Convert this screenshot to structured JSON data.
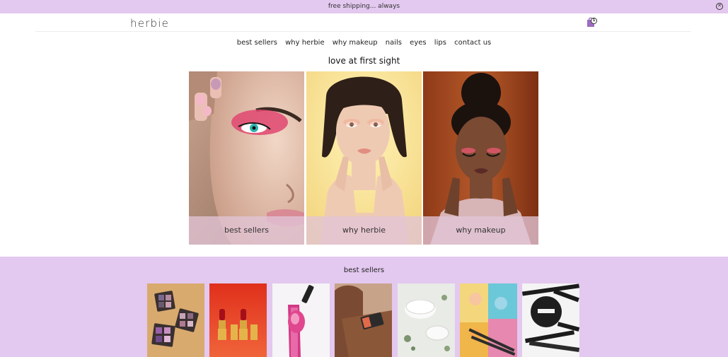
{
  "promo": {
    "text": "free shipping... always",
    "close_icon": "close-circle-icon"
  },
  "header": {
    "logo": "herbie",
    "cart_icon": "shopping-bag-icon",
    "cart_count": "1"
  },
  "nav": {
    "items": [
      {
        "label": "best sellers"
      },
      {
        "label": "why herbie"
      },
      {
        "label": "why makeup"
      },
      {
        "label": "nails"
      },
      {
        "label": "eyes"
      },
      {
        "label": "lips"
      },
      {
        "label": "contact us"
      }
    ]
  },
  "hero": {
    "title": "love at first sight",
    "tiles": [
      {
        "caption": "best sellers"
      },
      {
        "caption": "why herbie"
      },
      {
        "caption": "why makeup"
      }
    ]
  },
  "best_sellers": {
    "title": "best sellers",
    "products": [
      {
        "name": "eyeshadow palettes"
      },
      {
        "name": "red lipsticks"
      },
      {
        "name": "pink lip gloss"
      },
      {
        "name": "foundation tube"
      },
      {
        "name": "face cream jars"
      },
      {
        "name": "pigment powders and brushes"
      },
      {
        "name": "powder and brushes"
      }
    ]
  }
}
